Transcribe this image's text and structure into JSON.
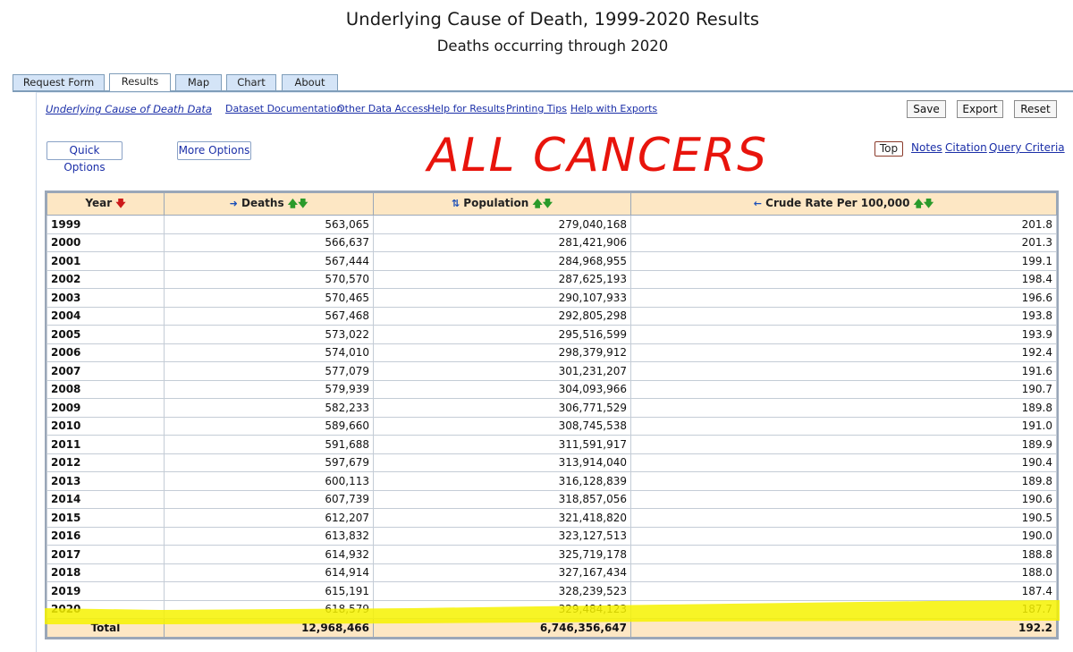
{
  "header": {
    "title": "Underlying Cause of Death, 1999-2020 Results",
    "subtitle": "Deaths occurring through 2020"
  },
  "tabs": [
    {
      "label": "Request Form",
      "active": false
    },
    {
      "label": "Results",
      "active": true
    },
    {
      "label": "Map",
      "active": false
    },
    {
      "label": "Chart",
      "active": false
    },
    {
      "label": "About",
      "active": false
    }
  ],
  "links": {
    "dataset": "Underlying Cause of Death Data",
    "documentation": "Dataset Documentation",
    "other_access": "Other Data Access",
    "help_results": "Help for Results",
    "printing_tips": "Printing Tips",
    "help_exports": "Help with Exports"
  },
  "buttons": {
    "save": "Save",
    "export": "Export",
    "reset": "Reset",
    "quick_options": "Quick Options",
    "more_options": "More Options"
  },
  "nav": {
    "top": "Top",
    "notes": "Notes",
    "citation": "Citation",
    "query_criteria": "Query Criteria"
  },
  "annotation": {
    "text": "ALL CANCERS",
    "color": "#e8140c",
    "highlight_color": "#f6f200"
  },
  "table": {
    "columns": [
      "Year",
      "Deaths",
      "Population",
      "Crude Rate Per 100,000"
    ],
    "rows": [
      [
        "1999",
        "563,065",
        "279,040,168",
        "201.8"
      ],
      [
        "2000",
        "566,637",
        "281,421,906",
        "201.3"
      ],
      [
        "2001",
        "567,444",
        "284,968,955",
        "199.1"
      ],
      [
        "2002",
        "570,570",
        "287,625,193",
        "198.4"
      ],
      [
        "2003",
        "570,465",
        "290,107,933",
        "196.6"
      ],
      [
        "2004",
        "567,468",
        "292,805,298",
        "193.8"
      ],
      [
        "2005",
        "573,022",
        "295,516,599",
        "193.9"
      ],
      [
        "2006",
        "574,010",
        "298,379,912",
        "192.4"
      ],
      [
        "2007",
        "577,079",
        "301,231,207",
        "191.6"
      ],
      [
        "2008",
        "579,939",
        "304,093,966",
        "190.7"
      ],
      [
        "2009",
        "582,233",
        "306,771,529",
        "189.8"
      ],
      [
        "2010",
        "589,660",
        "308,745,538",
        "191.0"
      ],
      [
        "2011",
        "591,688",
        "311,591,917",
        "189.9"
      ],
      [
        "2012",
        "597,679",
        "313,914,040",
        "190.4"
      ],
      [
        "2013",
        "600,113",
        "316,128,839",
        "189.8"
      ],
      [
        "2014",
        "607,739",
        "318,857,056",
        "190.6"
      ],
      [
        "2015",
        "612,207",
        "321,418,820",
        "190.5"
      ],
      [
        "2016",
        "613,832",
        "323,127,513",
        "190.0"
      ],
      [
        "2017",
        "614,932",
        "325,719,178",
        "188.8"
      ],
      [
        "2018",
        "614,914",
        "327,167,434",
        "188.0"
      ],
      [
        "2019",
        "615,191",
        "328,239,523",
        "187.4"
      ],
      [
        "2020",
        "618,579",
        "329,484,123",
        "187.7"
      ]
    ],
    "total": [
      "Total",
      "12,968,466",
      "6,746,356,647",
      "192.2"
    ]
  }
}
